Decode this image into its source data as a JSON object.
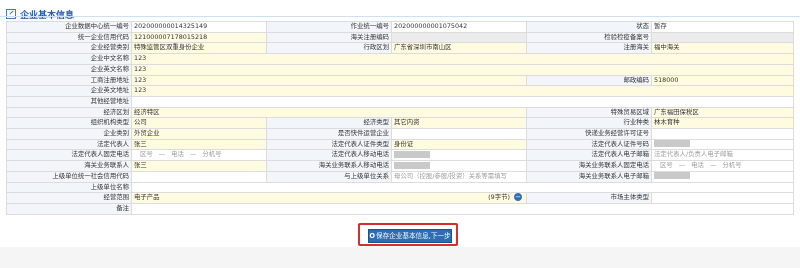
{
  "section_title": "企业基本信息",
  "rows": [
    [
      {
        "label": "企业数据中心统一编号",
        "value": "202000000014325149",
        "style": "white"
      },
      {
        "label": "作业统一编号",
        "value": "202000000001075042",
        "style": "white"
      },
      {
        "label": "状态",
        "value": "暂存",
        "style": "white"
      }
    ],
    [
      {
        "label": "统一企业信用代码",
        "value": "121000007178015218",
        "style": "yellow"
      },
      {
        "label": "海关注册编码",
        "value": "",
        "style": "gray"
      },
      {
        "label": "检验检疫备案号",
        "value": "",
        "style": "gray"
      }
    ],
    [
      {
        "label": "企业经营类别",
        "value": "特殊监管区双重身份企业",
        "style": "yellow"
      },
      {
        "label": "行政区划",
        "value": "广东省深圳市南山区",
        "style": "yellow"
      },
      {
        "label": "注册海关",
        "value": "福中海关",
        "style": "yellow"
      }
    ],
    [
      {
        "label": "企业中文名称",
        "value": "123",
        "style": "yellow",
        "span": 5
      }
    ],
    [
      {
        "label": "企业英文名称",
        "value": "123",
        "style": "yellow",
        "span": 5
      }
    ],
    [
      {
        "label": "工商注册地址",
        "value": "123",
        "style": "yellow",
        "span": 3
      },
      {
        "label": "邮政编码",
        "value": "518000",
        "style": "yellow"
      }
    ],
    [
      {
        "label": "企业英文地址",
        "value": "123",
        "style": "yellow",
        "span": 5
      }
    ],
    [
      {
        "label": "其他经营地址",
        "value": "",
        "style": "white",
        "span": 5
      }
    ],
    [
      {
        "label": "经济区划",
        "value": "经济特区",
        "style": "yellow",
        "span": 3
      },
      {
        "label": "特殊贸易区域",
        "value": "广东福田保税区",
        "style": "yellow"
      }
    ],
    [
      {
        "label": "组织机构类型",
        "value": "公司",
        "style": "yellow"
      },
      {
        "label": "经济类型",
        "value": "其它内资",
        "style": "yellow"
      },
      {
        "label": "行业种类",
        "value": "林木育种",
        "style": "yellow"
      }
    ],
    [
      {
        "label": "企业类别",
        "value": "外贸企业",
        "style": "yellow"
      },
      {
        "label": "是否快件运营企业",
        "value": "",
        "style": "white"
      },
      {
        "label": "快递业务经营许可证号",
        "value": "",
        "style": "white"
      }
    ],
    [
      {
        "label": "法定代表人",
        "value": "张三",
        "style": "yellow"
      },
      {
        "label": "法定代表人证件类型",
        "value": "身份证",
        "style": "yellow"
      },
      {
        "label": "法定代表人证件号码",
        "value": "",
        "style": "blur"
      }
    ],
    [
      {
        "label": "法定代表人固定电话",
        "value": [
          "区号",
          "电话",
          "分机号"
        ],
        "style": "phone"
      },
      {
        "label": "法定代表人移动电话",
        "value": "",
        "style": "blur"
      },
      {
        "label": "法定代表人电子邮箱",
        "value": "法定代表人/负责人电子邮箱",
        "style": "placeholder"
      }
    ],
    [
      {
        "label": "海关业务联系人",
        "value": "张三",
        "style": "yellow"
      },
      {
        "label": "海关业务联系人移动电话",
        "value": "",
        "style": "blur"
      },
      {
        "label": "海关业务联系人固定电话",
        "value": [
          "区号",
          "电话",
          "分机号"
        ],
        "style": "phone"
      }
    ],
    [
      {
        "label": "上级单位统一社会信用代码",
        "value": "",
        "style": "white"
      },
      {
        "label": "与上级单位关系",
        "value": "母公司（控股/参股/投资）关系等需填写",
        "style": "placeholder"
      },
      {
        "label": "海关业务联系人电子邮箱",
        "value": "",
        "style": "blur"
      }
    ],
    [
      {
        "label": "上级单位名称",
        "value": "",
        "style": "white",
        "span": 5
      }
    ],
    [
      {
        "label": "经营范围",
        "value": "电子产品",
        "style": "yellow",
        "span": 3,
        "suffix": "(9字节)"
      },
      {
        "label": "市场主体类型",
        "value": "",
        "style": "white"
      }
    ],
    [
      {
        "label": "备注",
        "value": "",
        "style": "white",
        "span": 5
      }
    ]
  ],
  "save_button_label": "保存企业基本信息,下一步",
  "save_button_prefix": "O",
  "minus_icon": "−"
}
